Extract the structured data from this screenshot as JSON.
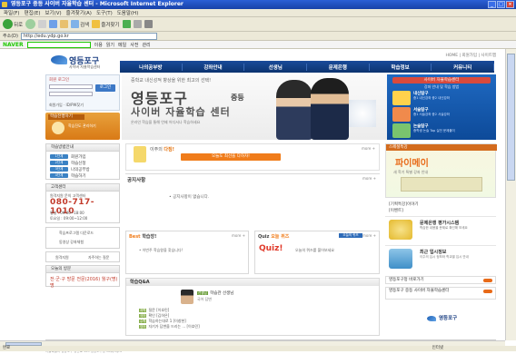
{
  "window": {
    "title": "영등포구 중등 사이버 자율학습 센터 - Microsoft Internet Explorer"
  },
  "menu": [
    "파일(F)",
    "편집(E)",
    "보기(V)",
    "즐겨찾기(A)",
    "도구(T)",
    "도움말(H)"
  ],
  "toolbar": {
    "back": "뒤로",
    "search": "검색",
    "favorites": "즐겨찾기"
  },
  "address": {
    "label": "주소(D)",
    "url": "http://edu.ydp.go.kr"
  },
  "naver": {
    "logo": "NAVER",
    "b1": "이용",
    "b2": "읽기",
    "b3": "메일",
    "b4": "사전",
    "b5": "관리"
  },
  "site": {
    "logo": "영등포구",
    "logo_sub": "사이버 자율학습센터",
    "topnav": "HOME | 회원가입 | 사이트맵",
    "nav": [
      "나의공부방",
      "강좌안내",
      "선생님",
      "문제은행",
      "학습정보",
      "커뮤니티"
    ],
    "login": {
      "title": "회원 로그인",
      "login_btn": "로그인",
      "links": "회원가입  ·  ID/PW찾기"
    },
    "learn_btn": {
      "title": "학습진행하기",
      "text": "학습진도\n관리하기"
    },
    "hero": {
      "top": "중학교 내신성적 향상을 위한 최고의 선택!",
      "t1": "영등포구",
      "t1s": "중등",
      "t2": "사이버 자율학습 센터",
      "t3": "온라인 학습을 통해 언제 어디서나 학습하세요"
    },
    "right_box": {
      "title": "사이버 자율학습센터",
      "sub": "강좌 안내 및 학습 방법",
      "items": [
        {
          "label": "내신탐구",
          "desc": "중1 내신강좌\n중2 내신강좌"
        },
        {
          "label": "서술탐구",
          "desc": "중1 서술강좌\n중2 서술강좌"
        },
        {
          "label": "논술탐구",
          "desc": "중학생 논술 Top\n실전 문제풀이"
        }
      ]
    },
    "left": {
      "guide_title": "학습방법안내",
      "guide": [
        "회원가입",
        "학습신청",
        "나의공부방",
        "학습하기"
      ],
      "support_title": "고객센터",
      "support_sub": "원격지원 문의 고객센터",
      "phone": "080-717-1010",
      "hours": [
        "평일 : 09:00~18:00",
        "토요일 : 09:00~12:00"
      ],
      "links": [
        "학습프로그램 다운로드",
        "동영상 강좌체험"
      ],
      "links2": [
        "원격지원",
        "자주하는 질문"
      ],
      "ad_title": "오늘의 방문",
      "ad": "전·군·구 방문\n전문(2016) 월구(명) 명"
    },
    "counsel": {
      "label": "이주의",
      "label_b": "다짐!",
      "bar": "오늘도 최선을 다하자!",
      "more": "more +"
    },
    "notice": {
      "title": "공지사항",
      "empty": "• 공지사항이 없습니다.",
      "more": "more +"
    },
    "best": {
      "title": "Best",
      "title_b": "학습장!",
      "sub": "열심히 학습하세요",
      "text": "• 이번주 학습왕을 찾습니다!",
      "more": "more +"
    },
    "quiz": {
      "title": "Quiz",
      "title_b": "오늘 퀴즈",
      "badge": "오늘의 퀴즈",
      "logo": "Quiz!",
      "text": "오늘의 퀴즈를 풀어보세요",
      "more": "more +"
    },
    "qa": {
      "title": "학습Q&A",
      "teacher": "학습관 선생님",
      "tag": "선생님",
      "sub": "국어 답변",
      "items": [
        {
          "tag": "과학",
          "text": "질문 [이호민]"
        },
        {
          "tag": "국어",
          "text": "확인 [김하은]"
        },
        {
          "tag": "수학",
          "text": "학습하는대로 1 [이창현]"
        },
        {
          "tag": "영어",
          "text": "자기가 답변을 드리는 ... [이호민]"
        }
      ]
    },
    "rc": {
      "head": "스페셜특강",
      "title": "파이메이",
      "sub": "새 학기 특별 강좌 안내",
      "l1": "[기획특강]이야기",
      "l2": "[이벤트]",
      "items": [
        {
          "title": "문제은행 평가시스템",
          "desc": "학습한 내용을 문제로 확인해 보세요"
        },
        {
          "title": "최근 입시정보",
          "desc": "이주의 입시 정보와 학교별 입시 안내"
        }
      ],
      "bars": [
        "영등포구청 바로가기",
        "영등포구 중등 사이버 자율학습센터"
      ]
    },
    "footer": {
      "links": [
        "회사소개",
        "개인정보보호정책",
        "이용약관"
      ],
      "copy": "서울특별시 영등포구 당산로 123 영등포구청 Copyright",
      "logo": "영등포구"
    }
  },
  "status": {
    "left": "완료",
    "zone": "인터넷"
  }
}
